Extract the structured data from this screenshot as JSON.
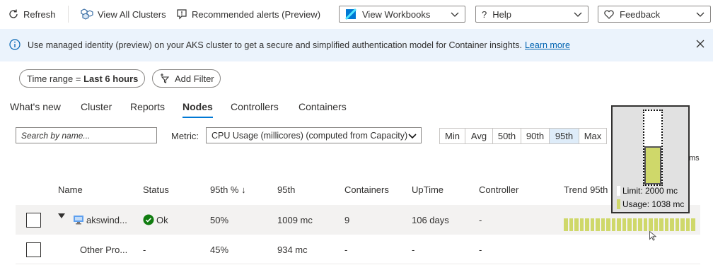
{
  "toolbar": {
    "refresh": "Refresh",
    "view_all_clusters": "View All Clusters",
    "recommended_alerts": "Recommended alerts (Preview)",
    "view_workbooks": "View Workbooks",
    "help": "Help",
    "feedback": "Feedback"
  },
  "banner": {
    "message": "Use managed identity (preview) on your AKS cluster to get a secure and simplified authentication model for Container insights.",
    "link": "Learn more"
  },
  "filters": {
    "time_range_label": "Time range = ",
    "time_range_value": "Last 6 hours",
    "add_filter": "Add Filter"
  },
  "tabs": [
    {
      "label": "What's new"
    },
    {
      "label": "Cluster"
    },
    {
      "label": "Reports"
    },
    {
      "label": "Nodes",
      "active": true
    },
    {
      "label": "Controllers"
    },
    {
      "label": "Containers"
    }
  ],
  "search": {
    "placeholder": "Search by name..."
  },
  "metric": {
    "label": "Metric:",
    "value": "CPU Usage (millicores) (computed from Capacity)"
  },
  "aggregations": [
    "Min",
    "Avg",
    "50th",
    "90th",
    "95th",
    "Max"
  ],
  "selected_aggregation": "95th",
  "table": {
    "headers": [
      "Name",
      "Status",
      "95th % ↓",
      "95th",
      "Containers",
      "UpTime",
      "Controller",
      "Trend 95th"
    ],
    "rows": [
      {
        "name": "akswind...",
        "status": "Ok",
        "pct": "50%",
        "value": "1009 mc",
        "containers": "9",
        "uptime": "106 days",
        "controller": "-"
      },
      {
        "name": "Other Pro...",
        "status": "-",
        "pct": "45%",
        "value": "934 mc",
        "containers": "-",
        "uptime": "-",
        "controller": "-"
      }
    ]
  },
  "tooltip": {
    "limit": "Limit: 2000 mc",
    "usage": "Usage: 1038 mc",
    "usage_fraction": 0.519
  },
  "trend_tail_label": "ms",
  "colors": {
    "accent": "#0078d4",
    "banner_bg": "#ebf3fc",
    "status_ok": "#107c10",
    "trend_fill": "#cfd86a"
  }
}
